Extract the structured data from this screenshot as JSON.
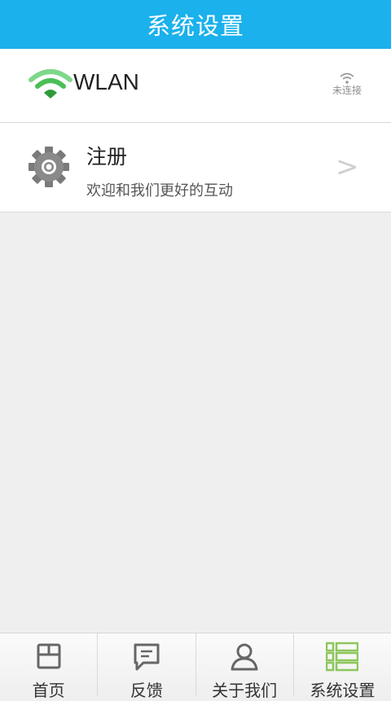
{
  "header": {
    "title": "系统设置"
  },
  "wlan": {
    "label": "WLAN",
    "status_text": "未连接"
  },
  "register": {
    "title": "注册",
    "subtitle": "欢迎和我们更好的互动",
    "chevron": ">"
  },
  "tabs": [
    {
      "label": "首页",
      "icon": "home-icon",
      "active": false
    },
    {
      "label": "反馈",
      "icon": "feedback-icon",
      "active": false
    },
    {
      "label": "关于我们",
      "icon": "user-icon",
      "active": false
    },
    {
      "label": "系统设置",
      "icon": "settings-list-icon",
      "active": true
    }
  ],
  "colors": {
    "header_bg": "#1ab1ec",
    "wifi_green": "#3fb04a",
    "tab_active": "#8cc65a",
    "tab_inactive": "#666666"
  }
}
